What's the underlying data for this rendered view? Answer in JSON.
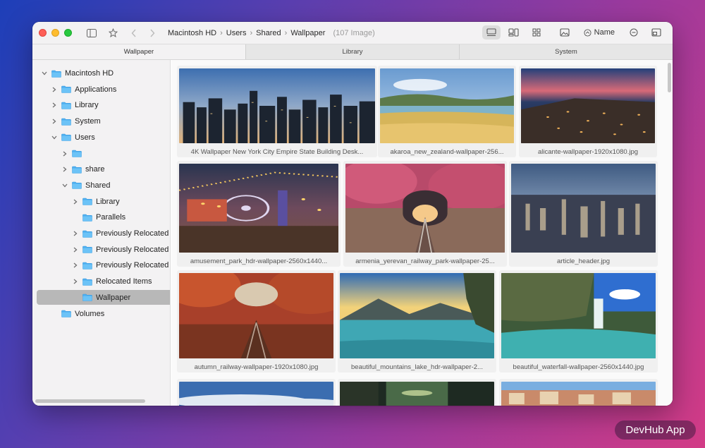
{
  "toolbar": {
    "breadcrumbs": [
      "Macintosh HD",
      "Users",
      "Shared",
      "Wallpaper"
    ],
    "item_count": "(107 Image)",
    "sort_label": "Name",
    "view_mode": "gallery"
  },
  "tabs": [
    {
      "label": "Wallpaper",
      "active": true
    },
    {
      "label": "Library",
      "active": false
    },
    {
      "label": "System",
      "active": false
    }
  ],
  "sidebar": {
    "items": [
      {
        "label": "Macintosh HD",
        "expanded": true
      },
      {
        "label": "Applications",
        "expanded": false
      },
      {
        "label": "Library",
        "expanded": false
      },
      {
        "label": "System",
        "expanded": false
      },
      {
        "label": "Users",
        "expanded": true
      },
      {
        "label": "",
        "expanded": false
      },
      {
        "label": "share",
        "expanded": false
      },
      {
        "label": "Shared",
        "expanded": true
      },
      {
        "label": "Library",
        "expanded": false
      },
      {
        "label": "Parallels",
        "expanded": false
      },
      {
        "label": "Previously Relocated It",
        "expanded": false
      },
      {
        "label": "Previously Relocated It",
        "expanded": false
      },
      {
        "label": "Previously Relocated It",
        "expanded": false
      },
      {
        "label": "Relocated Items",
        "expanded": false
      },
      {
        "label": "Wallpaper",
        "selected": true
      },
      {
        "label": "Volumes",
        "expanded": false
      }
    ]
  },
  "gallery": {
    "items": [
      {
        "caption": "4K Wallpaper   New York City Empire State Building Desk...",
        "scene": "city-night"
      },
      {
        "caption": "akaroa_new_zealand-wallpaper-256...",
        "scene": "lake-fields"
      },
      {
        "caption": "alicante-wallpaper-1920x1080.jpg",
        "scene": "coast-night"
      },
      {
        "caption": "amusement_park_hdr-wallpaper-2560x1440...",
        "scene": "amusement-park"
      },
      {
        "caption": "armenia_yerevan_railway_park-wallpaper-25...",
        "scene": "pink-tunnel"
      },
      {
        "caption": "article_header.jpg",
        "scene": "city-aerial"
      },
      {
        "caption": "autumn_railway-wallpaper-1920x1080.jpg",
        "scene": "autumn-forest"
      },
      {
        "caption": "beautiful_mountains_lake_hdr-wallpaper-2...",
        "scene": "mountain-lake"
      },
      {
        "caption": "beautiful_waterfall-wallpaper-2560x1440.jpg",
        "scene": "waterfall"
      },
      {
        "caption": "",
        "scene": "clouds"
      },
      {
        "caption": "",
        "scene": "night-street"
      },
      {
        "caption": "",
        "scene": "venice"
      }
    ]
  },
  "watermark": "DevHub App"
}
